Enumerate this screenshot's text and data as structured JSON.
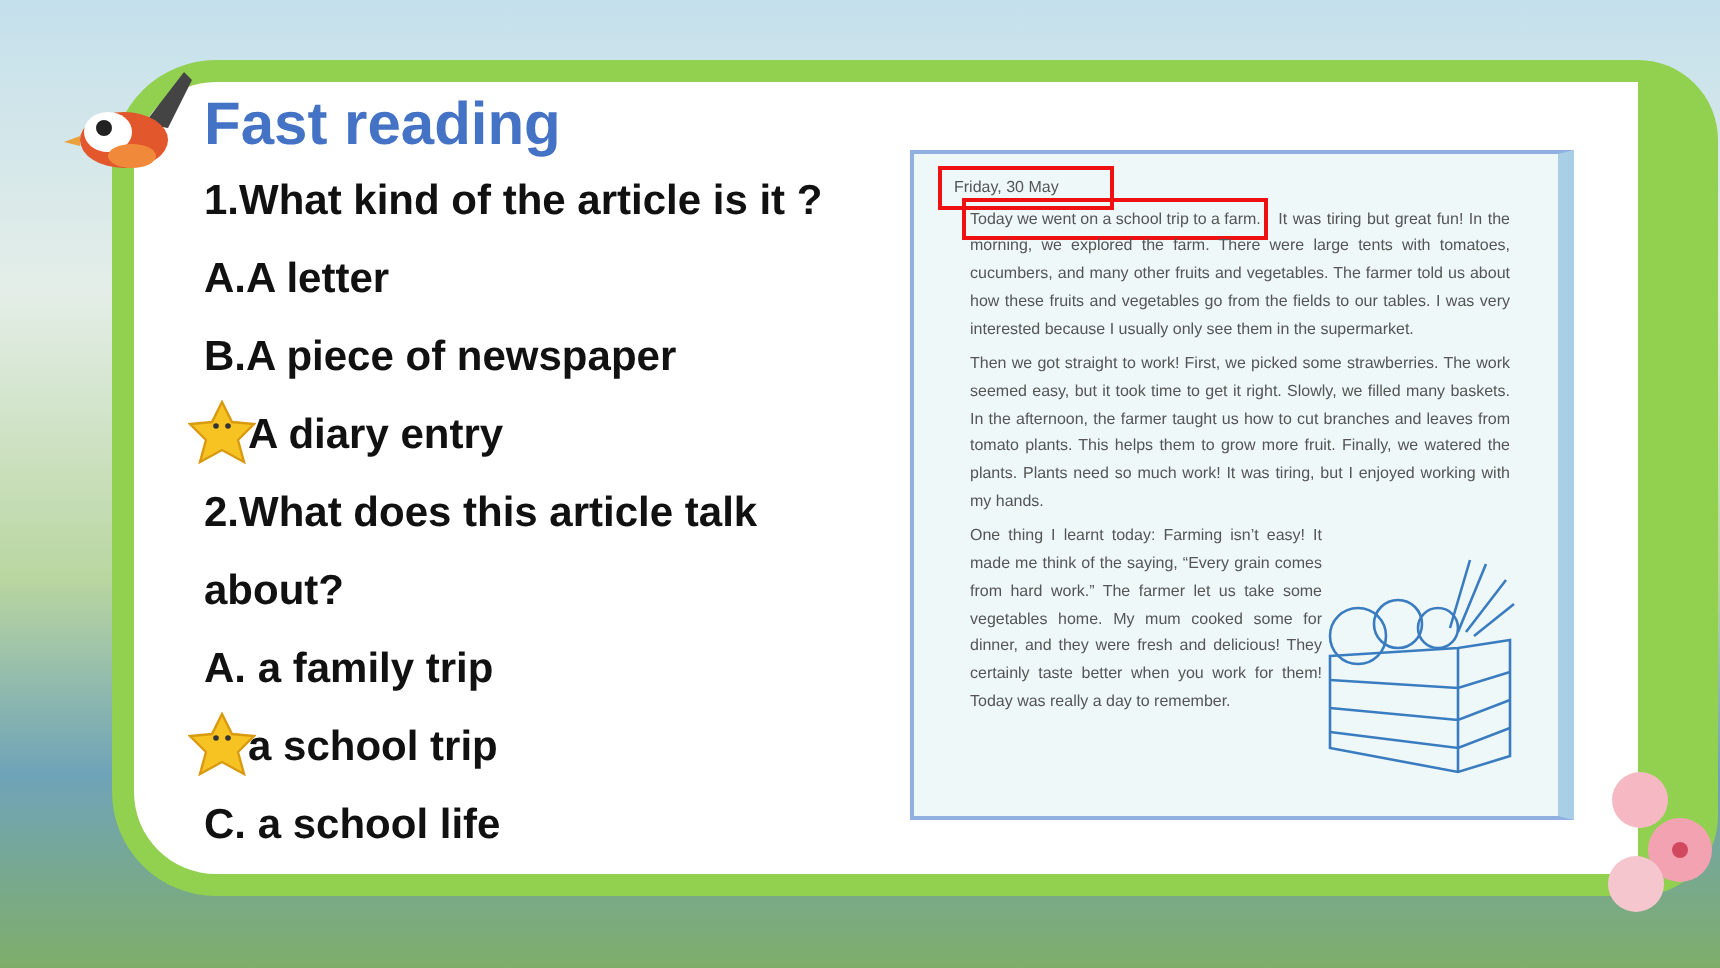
{
  "title": "Fast reading",
  "lines": [
    {
      "kind": "question",
      "text": "1.What kind of the article is it ?",
      "starred": false
    },
    {
      "kind": "option",
      "text": "A.A letter",
      "starred": false
    },
    {
      "kind": "option",
      "text": "B.A piece of newspaper",
      "starred": false
    },
    {
      "kind": "option",
      "text": "A diary  entry",
      "starred": true
    },
    {
      "kind": "question",
      "text": "2.What does this article talk about?",
      "starred": false
    },
    {
      "kind": "option",
      "text": "A. a family trip",
      "starred": false
    },
    {
      "kind": "option",
      "text": "a school trip",
      "starred": true
    },
    {
      "kind": "option",
      "text": "C. a school life",
      "starred": false
    }
  ],
  "article": {
    "date": {
      "text": "Friday, 30 May",
      "highlighted": true
    },
    "paragraphs": [
      {
        "segments": [
          {
            "text": "Today we went on a school trip to a farm.",
            "highlighted": true
          },
          {
            "text": " It was tiring but great fun! In the morning, we explored the farm. There were large tents with tomatoes, cucumbers, and many other fruits and vegetables. The farmer told us about how these fruits and vegetables go from the fields to our tables. I was very interested because I usually only see them in the supermarket.",
            "highlighted": false
          }
        ]
      },
      {
        "segments": [
          {
            "text": "Then we got straight to work! First, we picked some strawberries. The work seemed easy, but it took time to get it right. Slowly, we filled many baskets. In the afternoon, the farmer taught us how to cut branches and leaves from tomato plants. This helps them to grow more fruit. Finally, we watered the plants. Plants need so much work! It was tiring, but I enjoyed working with my hands.",
            "highlighted": false
          }
        ]
      },
      {
        "segments": [
          {
            "text": "One thing I learnt today: Farming isn’t easy! It made me think of the saying, “Every grain comes from hard work.” The farmer let us take some vegetables home. My mum cooked some for dinner, and they were fresh and delicious! They certainly taste better when you work for them! Today was really a day to remember.",
            "highlighted": false
          }
        ]
      }
    ]
  }
}
